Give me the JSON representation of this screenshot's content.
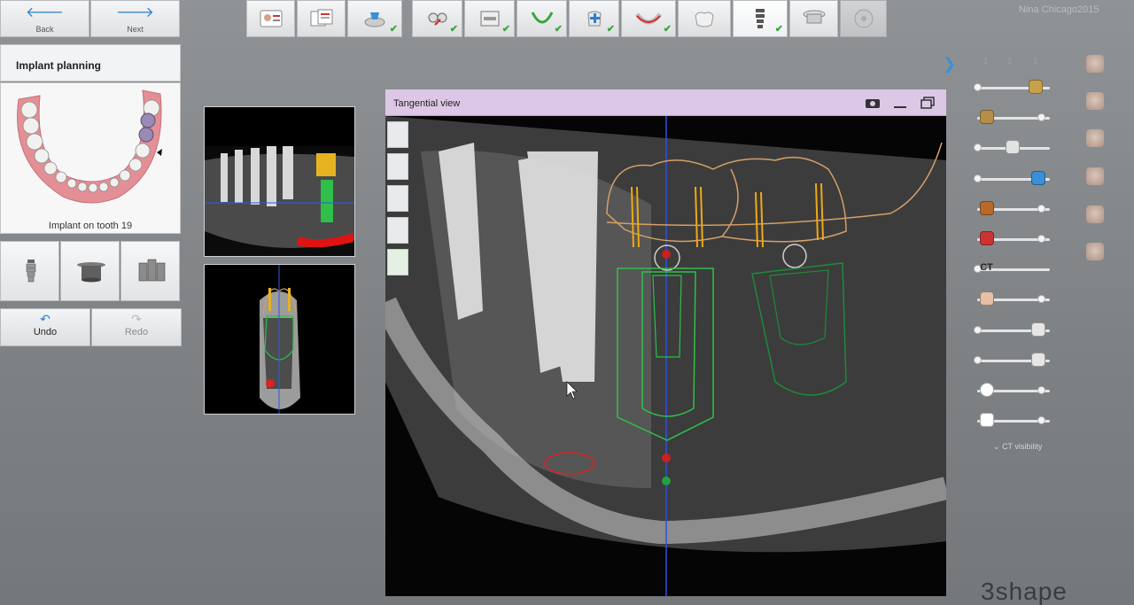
{
  "nav": {
    "back_label": "Back",
    "next_label": "Next"
  },
  "panel": {
    "title": "Implant planning",
    "jaw_caption": "Implant on tooth 19"
  },
  "history": {
    "undo_label": "Undo",
    "redo_label": "Redo"
  },
  "user": "Nina Chicago2015",
  "workflow_steps": [
    {
      "icon": "patient-card-icon",
      "done": false
    },
    {
      "icon": "order-form-icon",
      "done": false
    },
    {
      "icon": "scan-import-icon",
      "done": true
    },
    {
      "icon": "segmentation-icon",
      "done": true
    },
    {
      "icon": "ct-volume-icon",
      "done": true
    },
    {
      "icon": "arch-curve-icon",
      "done": true
    },
    {
      "icon": "add-tooth-icon",
      "done": true
    },
    {
      "icon": "nerve-icon",
      "done": true
    },
    {
      "icon": "crown-icon",
      "done": true
    },
    {
      "icon": "implant-icon",
      "done": true
    },
    {
      "icon": "sleeve-icon",
      "done": false
    },
    {
      "icon": "export-disc-icon",
      "done": false
    }
  ],
  "tangential": {
    "title": "Tangential view"
  },
  "sidebar": {
    "tab_numbers": [
      "1",
      "2",
      "3"
    ],
    "sliders": [
      {
        "icon": "crown-gold-icon",
        "level": 0.9
      },
      {
        "icon": "abutment-icon",
        "level": 0.05
      },
      {
        "icon": "tooth-icon",
        "level": 0.5
      },
      {
        "icon": "cylinder-icon",
        "level": 0.95
      },
      {
        "icon": "sleeve-bronze-icon",
        "level": 0.05
      },
      {
        "icon": "scissors-icon",
        "level": 0.05
      },
      {
        "icon": "ct-icon",
        "level": 0.05,
        "label": "CT"
      },
      {
        "icon": "face-icon",
        "level": 0.05
      },
      {
        "icon": "lower-jaw-icon",
        "level": 0.95
      },
      {
        "icon": "upper-jaw-icon",
        "level": 0.95
      },
      {
        "icon": "brightness-icon",
        "level": 0.05
      },
      {
        "icon": "contrast-icon",
        "level": 0.05
      }
    ],
    "ct_visibility": "CT visibility"
  },
  "brand": "3shape"
}
